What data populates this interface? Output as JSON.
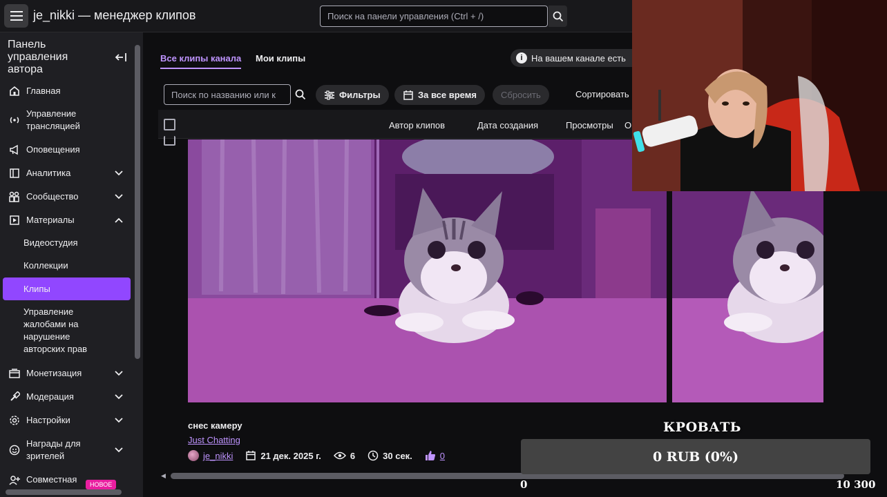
{
  "topbar": {
    "title": "je_nikki — менеджер клипов",
    "search_placeholder": "Поиск на панели управления (Ctrl + /)"
  },
  "sidebar": {
    "title": "Панель управления автора",
    "items": [
      {
        "label": "Главная",
        "icon": "home-icon"
      },
      {
        "label": "Управление трансляцией",
        "icon": "broadcast-icon"
      },
      {
        "label": "Оповещения",
        "icon": "megaphone-icon"
      },
      {
        "label": "Аналитика",
        "icon": "analytics-icon"
      },
      {
        "label": "Сообщество",
        "icon": "community-icon"
      },
      {
        "label": "Материалы",
        "icon": "content-icon"
      },
      {
        "label": "Монетизация",
        "icon": "monetization-icon"
      },
      {
        "label": "Модерация",
        "icon": "moderation-icon"
      },
      {
        "label": "Настройки",
        "icon": "settings-icon"
      },
      {
        "label": "Награды для зрителей",
        "icon": "rewards-icon"
      },
      {
        "label": "Совместная",
        "icon": "collab-icon"
      }
    ],
    "subitems": [
      "Видеостудия",
      "Коллекции",
      "Клипы",
      "Управление жалобами на нарушение авторских прав"
    ],
    "new_badge": "НОВОЕ",
    "accent": "#9147ff"
  },
  "main": {
    "tabs": [
      "Все клипы канала",
      "Мои клипы"
    ],
    "info_text": "На вашем канале есть",
    "search_placeholder": "Поиск по названию или к",
    "filters_label": "Фильтры",
    "period_label": "За все время",
    "reset_label": "Сбросить",
    "sort_label": "Сортировать",
    "columns": [
      "Автор клипов",
      "Дата создания",
      "Просмотры",
      "О"
    ]
  },
  "clip": {
    "title": "снес камеру",
    "category": "Just Chatting",
    "author": "je_nikki",
    "date": "21 дек. 2025 г.",
    "views": "6",
    "duration": "30 сек.",
    "likes": "0"
  },
  "overlay": {
    "goal_title": "КРОВАТЬ",
    "goal_progress": "0 RUB (0%)",
    "goal_min": "0",
    "goal_max": "10 300",
    "goal_fraction": 0
  }
}
